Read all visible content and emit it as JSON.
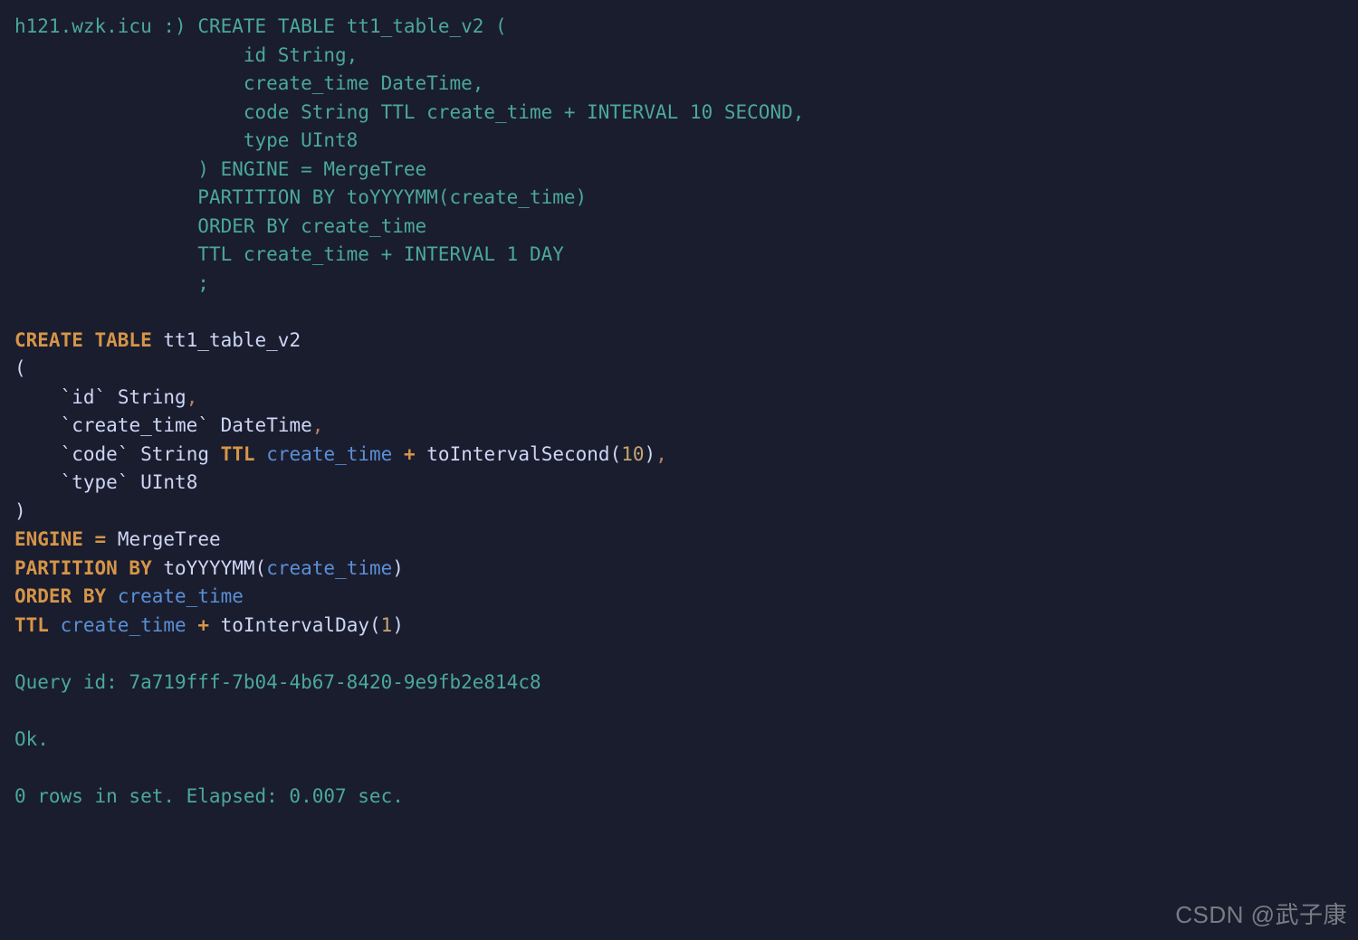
{
  "prompt": {
    "host": "h121.wzk.icu",
    "smiley": ":)",
    "input_lines": [
      "CREATE TABLE tt1_table_v2 (",
      "  id String,",
      "  create_time DateTime,",
      "  code String TTL create_time + INTERVAL 10 SECOND,",
      "  type UInt8",
      ") ENGINE = MergeTree",
      "PARTITION BY toYYYYMM(create_time)",
      "ORDER BY create_time",
      "TTL create_time + INTERVAL 1 DAY",
      ";"
    ]
  },
  "parsed": {
    "create_kw": "CREATE TABLE",
    "table_name": "tt1_table_v2",
    "open_paren": "(",
    "columns": [
      {
        "name": "id",
        "type": "String",
        "tail": ","
      },
      {
        "name": "create_time",
        "type": "DateTime",
        "tail": ","
      },
      {
        "name": "code",
        "type": "String",
        "ttl_kw": "TTL",
        "ttl_col": "create_time",
        "plus": "+",
        "ttl_func": "toIntervalSecond",
        "ttl_arg": "10",
        "tail": ","
      },
      {
        "name": "type",
        "type": "UInt8",
        "tail": ""
      }
    ],
    "close_paren": ")",
    "engine_kw": "ENGINE",
    "eq": "=",
    "engine": "MergeTree",
    "partition_kw": "PARTITION BY",
    "partition_func": "toYYYYMM",
    "partition_arg": "create_time",
    "order_kw": "ORDER BY",
    "order_col": "create_time",
    "ttl_kw": "TTL",
    "ttl_col": "create_time",
    "ttl_plus": "+",
    "ttl_func": "toIntervalDay",
    "ttl_arg": "1"
  },
  "result": {
    "query_id_label": "Query id:",
    "query_id": "7a719fff-7b04-4b67-8420-9e9fb2e814c8",
    "ok": "Ok.",
    "rows_line": "0 rows in set. Elapsed: 0.007 sec."
  },
  "watermark": "CSDN @武子康"
}
